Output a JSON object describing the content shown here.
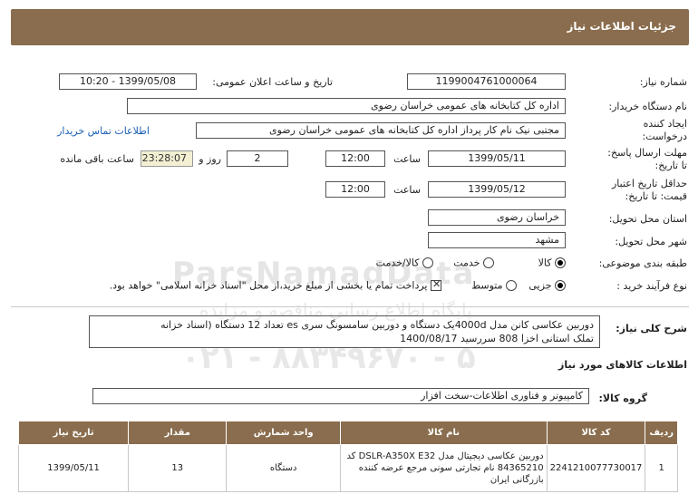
{
  "header": {
    "title": "جزئیات اطلاعات نیاز"
  },
  "form": {
    "need_number_label": "شماره نیاز:",
    "need_number": "1199004761000064",
    "announce_label": "تاریخ و ساعت اعلان عمومی:",
    "announce_value": "1399/05/08 - 10:20",
    "buyer_label": "نام دستگاه خریدار:",
    "buyer_value": "اداره کل  کتابخانه های عمومی خراسان رضوی",
    "creator_label_1": "ایجاد کننده",
    "creator_label_2": "درخواست:",
    "creator_value": "مجتبی نیک نام کار پرداز اداره کل  کتابخانه های عمومی خراسان رضوی",
    "contact_link": "اطلاعات تماس خریدار",
    "deadline_label_1": "مهلت ارسال پاسخ:",
    "deadline_label_2": "تا تاریخ:",
    "deadline_date": "1399/05/11",
    "time_label": "ساعت",
    "deadline_time": "12:00",
    "days_value": "2",
    "days_label": "روز و",
    "timer_value": "23:28:07",
    "remaining_label": "ساعت باقی مانده",
    "validity_label_1": "حداقل تاریخ اعتبار",
    "validity_label_2": "قیمت: تا تاریخ:",
    "validity_date": "1399/05/12",
    "validity_time": "12:00",
    "province_label": "استان محل تحویل:",
    "province_value": "خراسان رضوی",
    "city_label": "شهر محل تحویل:",
    "city_value": "مشهد",
    "category_label": "طبقه بندی موضوعی:",
    "category_options": [
      "کالا",
      "خدمت",
      "کالا/خدمت"
    ],
    "process_label": "نوع فرآیند خرید :",
    "process_options": [
      "جزیی",
      "متوسط"
    ],
    "payment_note": "پرداخت تمام یا بخشی از مبلغ خرید،از محل \"اسناد خزانه اسلامی\" خواهد بود."
  },
  "description": {
    "label": "شرح کلی نیاز:",
    "line1": "دوربین عکاسی کانن مدل 4000dیک دستگاه و دوربین سامسونگ سری es تعداد 12 دستگاه (اسناد خزانه",
    "line2": "تملک استانی اخزا 808 سررسید  1400/08/17"
  },
  "goods": {
    "section_title": "اطلاعات کالاهای مورد نیاز",
    "group_label": "گروه کالا:",
    "group_value": "کامپیوتر و فناوری اطلاعات-سخت افزار",
    "columns": [
      "ردیف",
      "کد کالا",
      "نام کالا",
      "واحد شمارش",
      "مقدار",
      "تاریخ نیاز"
    ],
    "rows": [
      {
        "row": "1",
        "code": "2241210077730017",
        "name": "دوربین عکاسی دیجیتال مدل DSLR-A350X E32 کد 84365210 نام تجارتی سونی مرجع عرضه کننده بازرگانی ایران",
        "unit": "دستگاه",
        "qty": "13",
        "date": "1399/05/11"
      }
    ]
  },
  "watermark": {
    "brand": "ParsNamadData",
    "tagline": "پایگاه اطلاع رسانی مناقصه و مزایده",
    "phone": "۰۲۱ - ۸۸۳۴۹۶۷۰ - ۵"
  }
}
